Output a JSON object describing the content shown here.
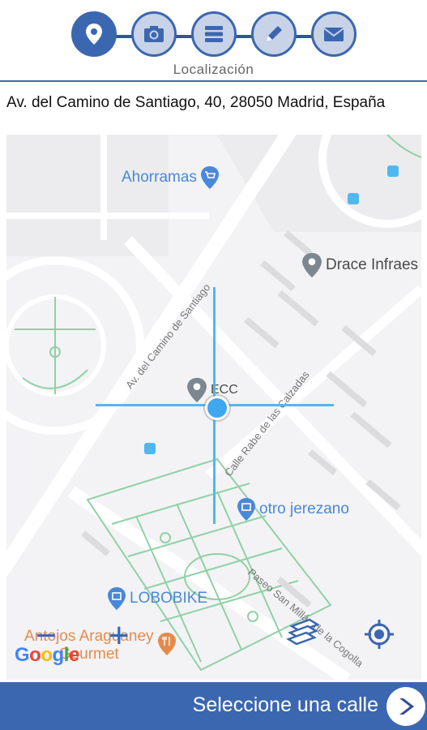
{
  "steps": [
    {
      "name": "location-step",
      "icon": "location-pin-icon",
      "active": true
    },
    {
      "name": "camera-step",
      "icon": "camera-icon",
      "active": false
    },
    {
      "name": "list-step",
      "icon": "list-icon",
      "active": false
    },
    {
      "name": "pencil-step",
      "icon": "pencil-icon",
      "active": false
    },
    {
      "name": "mail-step",
      "icon": "mail-icon",
      "active": false
    }
  ],
  "step_label": "Localización",
  "address": "Av. del Camino de Santiago, 40, 28050 Madrid, España",
  "map": {
    "pois": {
      "ahorramas": "Ahorramas",
      "drace": "Drace Infraes",
      "ecc": "ECC",
      "otro_jerezano": "otro jerezano",
      "lobobike": "LOBOBIKE",
      "antojos_line1": "Antojos Araguaney",
      "antojos_line2": "Gourmet"
    },
    "streets": {
      "camino_santiago": "Av. del Camino de Santiago",
      "rabe_calzadas": "Calle Rabe de las Calzadas",
      "paseo_san_millan": "Paseo San Millán de la Cogolla"
    },
    "zoom_out": "−",
    "zoom_in": "+",
    "google_logo": "Google",
    "layers_icon": "layers-icon",
    "locate_icon": "crosshair-icon"
  },
  "footer": {
    "label": "Seleccione una calle",
    "next_icon": "chevron-right-icon"
  },
  "colors": {
    "primary": "#3b67b0",
    "crosshair": "#4fb8f0",
    "poi_blue": "#4a88d8",
    "poi_gray": "#7c8790",
    "poi_orange": "#e48b4b",
    "park_green": "#8fd1a6"
  }
}
